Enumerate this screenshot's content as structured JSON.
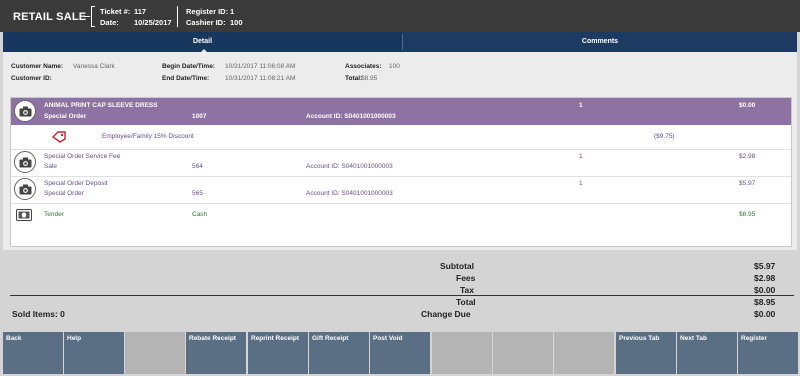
{
  "header": {
    "title": "RETAIL SALE",
    "ticket_label": "Ticket #:",
    "ticket_value": "117",
    "date_label": "Date:",
    "date_value": "10/25/2017",
    "register_label": "Register ID:",
    "register_value": "1",
    "cashier_label": "Cashier ID:",
    "cashier_value": "100"
  },
  "tabs": [
    {
      "label": "Detail",
      "active": true
    },
    {
      "label": "Comments",
      "active": false
    }
  ],
  "info": {
    "customer_name_label": "Customer Name:",
    "customer_name_value": "Vanessa Clark",
    "customer_id_label": "Customer ID:",
    "customer_id_value": "",
    "begin_label": "Begin Date/Time:",
    "begin_value": "10/31/2017 11:06:08 AM",
    "end_label": "End Date/Time:",
    "end_value": "10/31/2017 11:08:21 AM",
    "associates_label": "Associates:",
    "associates_value": "100",
    "total_label": "Total:",
    "total_value": "$8.95"
  },
  "items": {
    "row1": {
      "name": "ANIMAL PRINT CAP SLEEVE DRESS",
      "type": "Special Order",
      "number": "1007",
      "account": "Account ID: S0401001000003",
      "qty": "1",
      "amount": "$0.00"
    },
    "discount": {
      "label": "Employee/Family 15% Discount",
      "amount": "($9.75)"
    },
    "row2": {
      "name": "Special Order Service Fee",
      "type": "Sale",
      "number": "564",
      "account": "Account ID: S0401001000003",
      "qty": "1",
      "amount": "$2.98"
    },
    "row3": {
      "name": "Special Order Deposit",
      "type": "Special Order",
      "number": "565",
      "account": "Account ID: S0401001000003",
      "qty": "1",
      "amount": "$5.97"
    },
    "tender": {
      "label": "Tender",
      "method": "Cash",
      "amount": "$8.95"
    }
  },
  "totals": {
    "subtotal_label": "Subtotal",
    "subtotal_value": "$5.97",
    "fees_label": "Fees",
    "fees_value": "$2.98",
    "tax_label": "Tax",
    "tax_value": "$0.00",
    "total_label": "Total",
    "total_value": "$8.95",
    "change_label": "Change Due",
    "change_value": "$0.00",
    "sold_items": "Sold Items: 0"
  },
  "buttons": [
    "Back",
    "Help",
    "",
    "Rebate Receipt",
    "Reprint Receipt",
    "Gift Receipt",
    "Post Void",
    "",
    "",
    "",
    "Previous Tab",
    "Next Tab",
    "Register"
  ],
  "colors": {
    "header_bg": "#3a3a3a",
    "tab_bar": "#1d3a63",
    "selected_row": "#8e72a3",
    "button": "#5a6f84",
    "button_blank": "#b4b4b4"
  }
}
